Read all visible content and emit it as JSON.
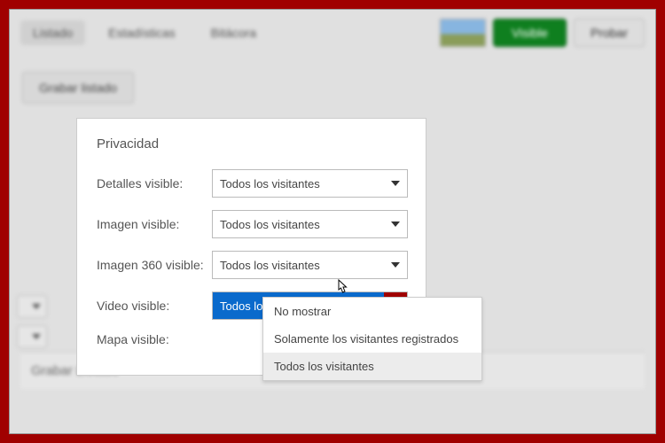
{
  "tabs": {
    "items": [
      {
        "label": "Listado",
        "active": true
      },
      {
        "label": "Estadísticas",
        "active": false
      },
      {
        "label": "Bitácora",
        "active": false
      }
    ]
  },
  "header": {
    "status_button": "Visible",
    "test_button": "Probar"
  },
  "toolbar": {
    "save_list": "Grabar listado"
  },
  "panel": {
    "title": "Privacidad",
    "rows": {
      "details": {
        "label": "Detalles visible:",
        "value": "Todos los visitantes"
      },
      "image": {
        "label": "Imagen visible:",
        "value": "Todos los visitantes"
      },
      "image360": {
        "label": "Imagen 360 visible:",
        "value": "Todos los visitantes"
      },
      "video": {
        "label": "Video visible:",
        "value": "Todos los visitantes"
      },
      "map": {
        "label": "Mapa visible:",
        "value": ""
      }
    }
  },
  "dropdown": {
    "options": [
      "No mostrar",
      "Solamente los visitantes registrados",
      "Todos los visitantes"
    ],
    "hovered_index": 2
  },
  "footer": {
    "save_list": "Grabar Listado"
  }
}
